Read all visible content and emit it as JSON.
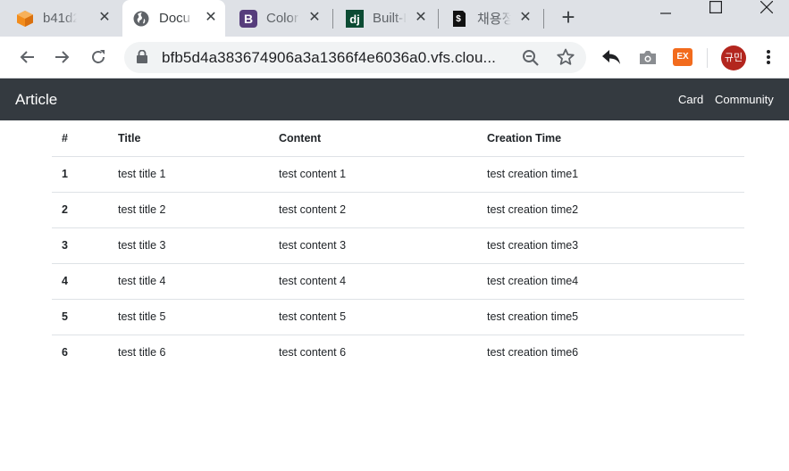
{
  "browser": {
    "tabs": [
      {
        "title": "b41d2",
        "icon": "box-icon"
      },
      {
        "title": "Docu",
        "icon": "globe-icon",
        "active": true
      },
      {
        "title": "Color",
        "icon": "bootstrap-icon"
      },
      {
        "title": "Built-I",
        "icon": "django-icon"
      },
      {
        "title": "채용정",
        "icon": "dollar-doc-icon"
      }
    ],
    "url": "bfb5d4a383674906a3a1366f4e6036a0.vfs.clou...",
    "extension_label": "EX",
    "avatar_label": "규민"
  },
  "navbar": {
    "brand": "Article",
    "links": [
      "Card",
      "Community"
    ]
  },
  "table": {
    "headers": [
      "#",
      "Title",
      "Content",
      "Creation Time"
    ],
    "rows": [
      [
        "1",
        "test title 1",
        "test content 1",
        "test creation time1"
      ],
      [
        "2",
        "test title 2",
        "test content 2",
        "test creation time2"
      ],
      [
        "3",
        "test title 3",
        "test content 3",
        "test creation time3"
      ],
      [
        "4",
        "test title 4",
        "test content 4",
        "test creation time4"
      ],
      [
        "5",
        "test title 5",
        "test content 5",
        "test creation time5"
      ],
      [
        "6",
        "test title 6",
        "test content 6",
        "test creation time6"
      ]
    ]
  },
  "colors": {
    "navbar_bg": "#343a40",
    "tabstrip_bg": "#dee1e6",
    "avatar_bg": "#b3261e",
    "extension_bg": "#f26b1d"
  }
}
